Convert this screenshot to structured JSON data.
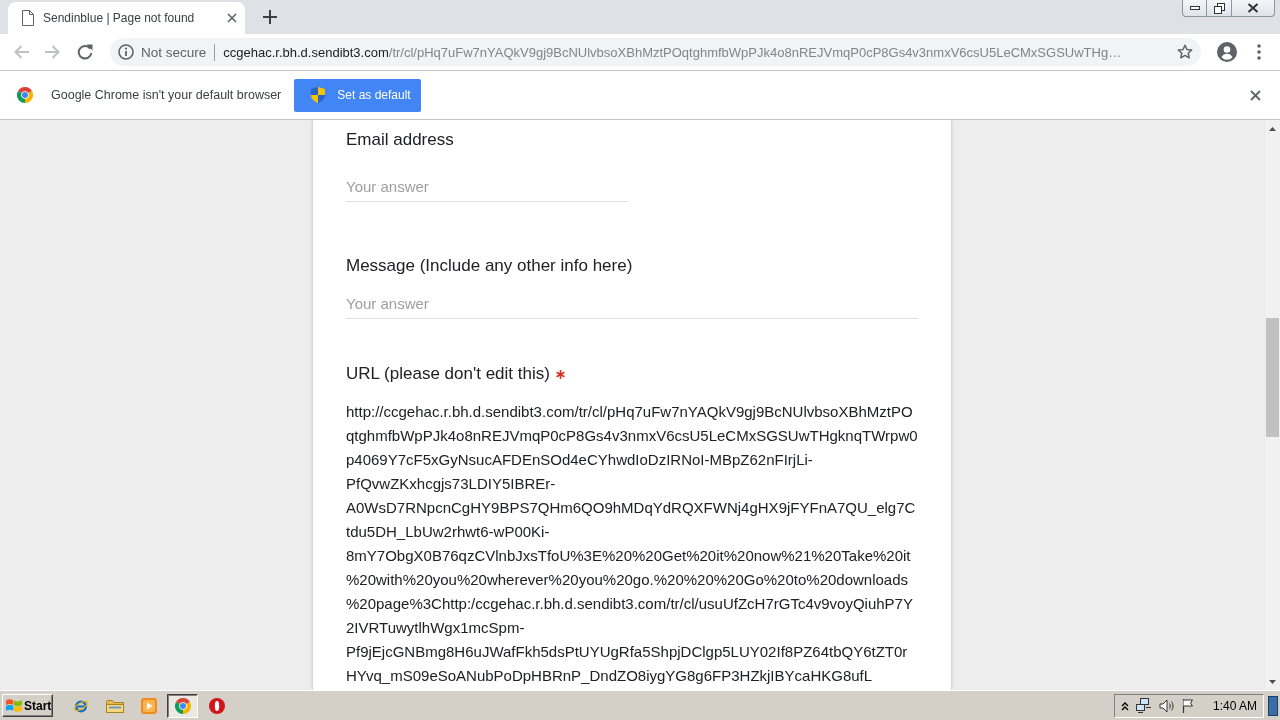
{
  "browser": {
    "tabs": [
      {
        "title": "Sendinblue | Page not found",
        "selected": true
      }
    ],
    "address_bar": {
      "security": "Not secure",
      "host": "ccgehac.r.bh.d.sendibt3.com",
      "path": "/tr/cl/pHq7uFw7nYAQkV9gj9BcNUlvbsoXBhMztPOqtghmfbWpPJk4o8nREJVmqP0cP8Gs4v3nmxV6csU5LeCMxSGSUwTHg…"
    }
  },
  "infobar": {
    "message": "Google Chrome isn't your default browser",
    "button": "Set as default"
  },
  "form": {
    "questions": [
      {
        "kind": "short_answer",
        "label": "Email address",
        "required": false,
        "placeholder": "Your answer"
      },
      {
        "kind": "paragraph",
        "label": "Message (Include any other info here)",
        "required": false,
        "placeholder": "Your answer"
      },
      {
        "kind": "text",
        "label": "URL (please don't edit this)",
        "required": true,
        "value": "http://ccgehac.r.bh.d.sendibt3.com/tr/cl/pHq7uFw7nYAQkV9gj9BcNUlvbsoXBhMztPOqtghmfbWpPJk4o8nREJVmqP0cP8Gs4v3nmxV6csU5LeCMxSGSUwTHgknqTWrpw0p4069Y7cF5xGyNsucAFDEnSOd4eCYhwdIoDzIRNoI-MBpZ62nFIrjLi-PfQvwZKxhcgjs73LDIY5IBREr-A0WsD7RNpcnCgHY9BPS7QHm6QO9hMDqYdRQXFWNj4gHX9jFYFnA7QU_elg7Ctdu5DH_LbUw2rhwt6-wP00Ki-8mY7ObgX0B76qzCVlnbJxsTfoU%3E%20%20Get%20it%20now%21%20Take%20it%20with%20you%20wherever%20you%20go.%20%20%20Go%20to%20downloads%20page%3Chttp:/ccgehac.r.bh.d.sendibt3.com/tr/cl/usuUfZcH7rGTc4v9voyQiuhP7Y2IVRTuwytlhWgx1mcSpm-Pf9jEjcGNBmg8H6uJWafFkh5dsPtUYUgRfa5ShpjDClgp5LUY02If8PZ64tbQY6tZT0rHYvq_mS09eSoANubPoDpHBRnP_DndZO8iygYG8g6FP3HZkjIBYcaHKG8ufL"
      }
    ]
  },
  "taskbar": {
    "start": "Start",
    "apps": [
      {
        "selected": false
      },
      {
        "selected": false
      },
      {
        "selected": false
      },
      {
        "selected": true
      },
      {
        "selected": false
      }
    ],
    "clock": "1:40 AM"
  }
}
